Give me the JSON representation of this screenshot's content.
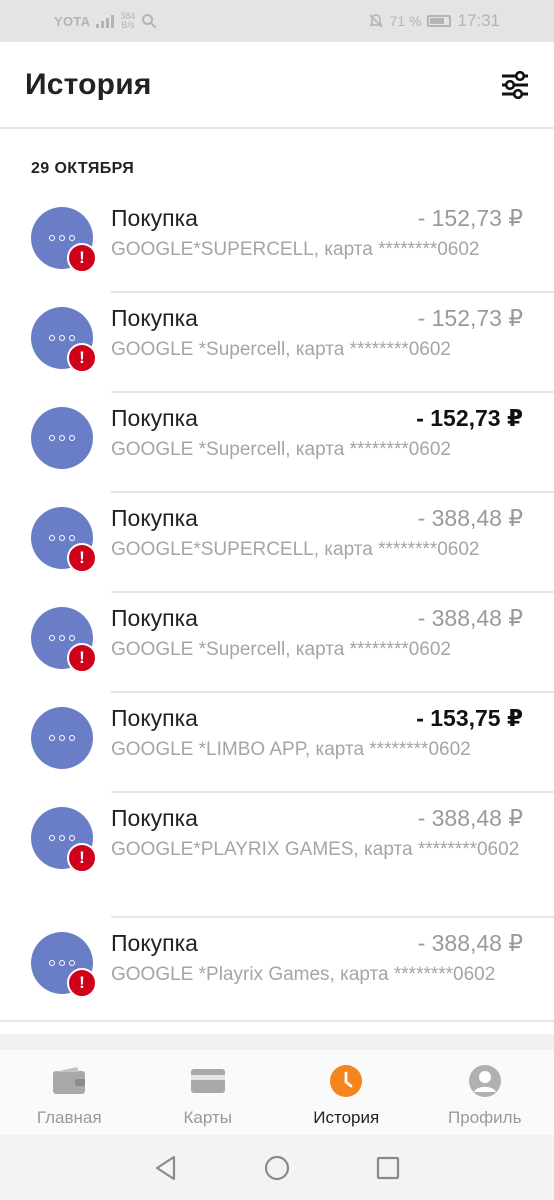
{
  "status_bar": {
    "carrier": "YOTA",
    "net_speed_value": "384",
    "net_speed_unit": "B/s",
    "battery": "71 %",
    "time": "17:31"
  },
  "header": {
    "title": "История",
    "filter_icon": "sliders-icon"
  },
  "section": {
    "date": "29 ОКТЯБРЯ"
  },
  "transactions": [
    {
      "title": "Покупка",
      "amount": "- 152,73 ₽",
      "description": "GOOGLE*SUPERCELL, карта ********0602",
      "alert": true,
      "emphasized": false
    },
    {
      "title": "Покупка",
      "amount": "- 152,73 ₽",
      "description": "GOOGLE *Supercell, карта ********0602",
      "alert": true,
      "emphasized": false
    },
    {
      "title": "Покупка",
      "amount": "- 152,73 ₽",
      "description": "GOOGLE *Supercell, карта ********0602",
      "alert": false,
      "emphasized": true
    },
    {
      "title": "Покупка",
      "amount": "- 388,48 ₽",
      "description": "GOOGLE*SUPERCELL, карта ********0602",
      "alert": true,
      "emphasized": false
    },
    {
      "title": "Покупка",
      "amount": "- 388,48 ₽",
      "description": "GOOGLE *Supercell, карта ********0602",
      "alert": true,
      "emphasized": false
    },
    {
      "title": "Покупка",
      "amount": "- 153,75 ₽",
      "description": "GOOGLE *LIMBO APP, карта ********0602",
      "alert": false,
      "emphasized": true
    },
    {
      "title": "Покупка",
      "amount": "- 388,48 ₽",
      "description": "GOOGLE*PLAYRIX GAMES, карта ********0602",
      "alert": true,
      "emphasized": false
    },
    {
      "title": "Покупка",
      "amount": "- 388,48 ₽",
      "description": "GOOGLE *Playrix Games, карта ********0602",
      "alert": true,
      "emphasized": false
    }
  ],
  "bottom_nav": [
    {
      "label": "Главная",
      "icon": "wallet-icon",
      "active": false
    },
    {
      "label": "Карты",
      "icon": "card-icon",
      "active": false
    },
    {
      "label": "История",
      "icon": "clock-icon",
      "active": true
    },
    {
      "label": "Профиль",
      "icon": "user-icon",
      "active": false
    }
  ],
  "colors": {
    "accent": "#f5841f",
    "avatar": "#6a7ec7",
    "alert": "#d0021b"
  }
}
